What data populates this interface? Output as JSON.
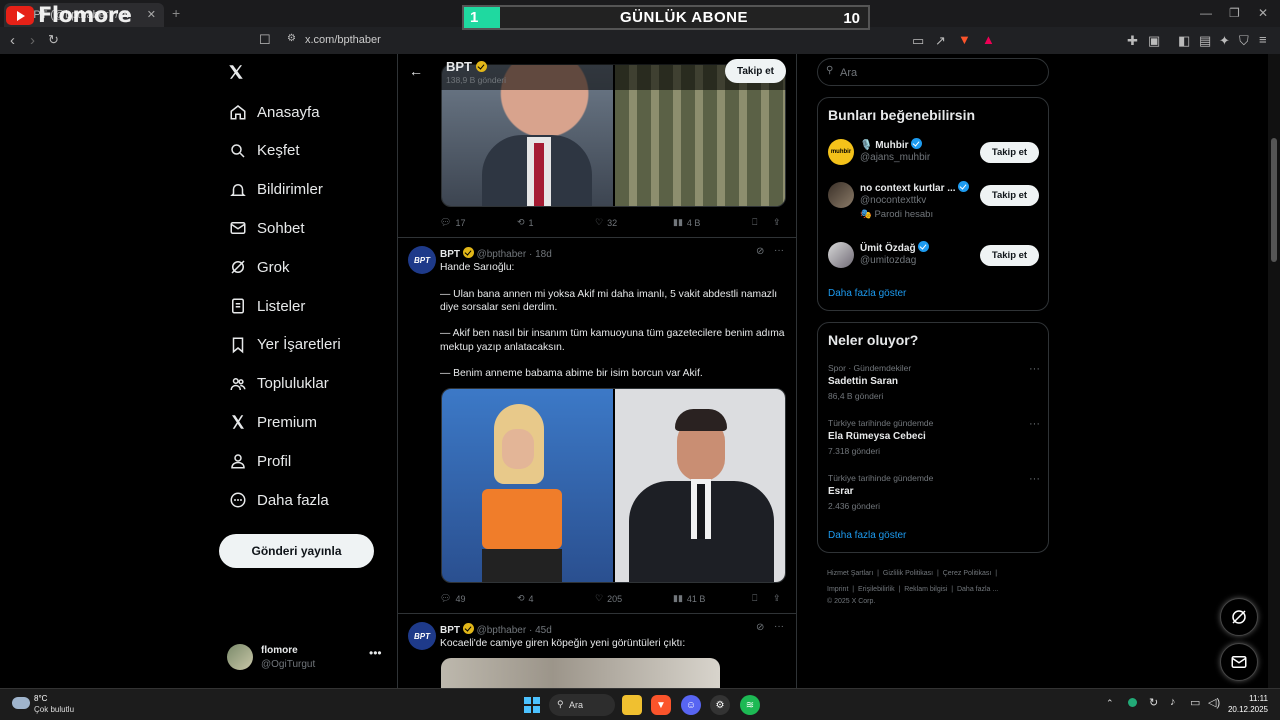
{
  "browser": {
    "tab_title": "BPT (@bpthaber) / X",
    "brand_overlay": "Flomore",
    "url": "x.com/bpthaber",
    "counter": {
      "left_value": "1",
      "title": "GÜNLÜK ABONE",
      "right_value": "10"
    }
  },
  "nav": {
    "items": [
      {
        "label": "Anasayfa",
        "icon": "home-icon"
      },
      {
        "label": "Keşfet",
        "icon": "search-icon"
      },
      {
        "label": "Bildirimler",
        "icon": "bell-icon"
      },
      {
        "label": "Sohbet",
        "icon": "mail-icon"
      },
      {
        "label": "Grok",
        "icon": "grok-icon"
      },
      {
        "label": "Listeler",
        "icon": "list-icon"
      },
      {
        "label": "Yer İşaretleri",
        "icon": "bookmark-icon"
      },
      {
        "label": "Topluluklar",
        "icon": "people-icon"
      },
      {
        "label": "Premium",
        "icon": "x-icon"
      },
      {
        "label": "Profil",
        "icon": "person-icon"
      },
      {
        "label": "Daha fazla",
        "icon": "more-circle-icon"
      }
    ],
    "post_button": "Gönderi yayınla",
    "account": {
      "name": "flomore",
      "handle": "@OgiTurgut"
    }
  },
  "profile_header": {
    "name": "BPT",
    "posts": "138,9 B gönderi",
    "follow": "Takip et"
  },
  "tweets": [
    {
      "metrics": {
        "replies": "17",
        "retweets": "1",
        "likes": "32",
        "views": "4 B"
      }
    },
    {
      "name": "BPT",
      "handle": "@bpthaber",
      "time": "18d",
      "text": "Hande Sarıoğlu:\n\n— Ulan bana annen mi yoksa Akif mi daha imanlı, 5 vakit abdestli namazlı diye sorsalar seni derdim.\n\n— Akif ben nasıl bir insanım tüm kamuoyuna tüm gazetecilere benim adıma mektup yazıp anlatacaksın.\n\n— Benim anneme babama abime bir isim borcun var Akif.",
      "metrics": {
        "replies": "49",
        "retweets": "4",
        "likes": "205",
        "views": "41 B"
      }
    },
    {
      "name": "BPT",
      "handle": "@bpthaber",
      "time": "45d",
      "text": "Kocaeli'de camiye giren köpeğin yeni görüntüleri çıktı:"
    }
  ],
  "sidebar": {
    "search_placeholder": "Ara",
    "suggest_title": "Bunları beğenebilirsin",
    "suggestions": [
      {
        "name": "🎙️ Muhbir",
        "handle": "@ajans_muhbir",
        "extra": "",
        "button": "Takip et"
      },
      {
        "name": "no context kurtlar ...",
        "handle": "@nocontexttkv",
        "extra": "🎭 Parodi hesabı",
        "button": "Takip et"
      },
      {
        "name": "Ümit Özdağ",
        "handle": "@umitozdag",
        "extra": "",
        "button": "Takip et"
      }
    ],
    "show_more": "Daha fazla göster",
    "trends_title": "Neler oluyor?",
    "trends": [
      {
        "context": "Spor · Gündemdekiler",
        "title": "Sadettin Saran",
        "posts": "86,4 B gönderi"
      },
      {
        "context": "Türkiye tarihinde gündemde",
        "title": "Ela Rümeysa Cebeci",
        "posts": "7.318 gönderi"
      },
      {
        "context": "Türkiye tarihinde gündemde",
        "title": "Esrar",
        "posts": "2.436 gönderi"
      }
    ],
    "show_more2": "Daha fazla göster",
    "footer": {
      "l1": "Hizmet Şartları",
      "l2": "Gizlilik Politikası",
      "l3": "Çerez Politikası",
      "l4": "Imprint",
      "l5": "Erişilebilirlik",
      "l6": "Reklam bilgisi",
      "l7": "Daha fazla ...",
      "copy": "© 2025 X Corp."
    }
  },
  "taskbar": {
    "weather_temp": "8°C",
    "weather_desc": "Çok bulutlu",
    "search": "Ara",
    "time": "11:11",
    "date": "20.12.2025"
  }
}
